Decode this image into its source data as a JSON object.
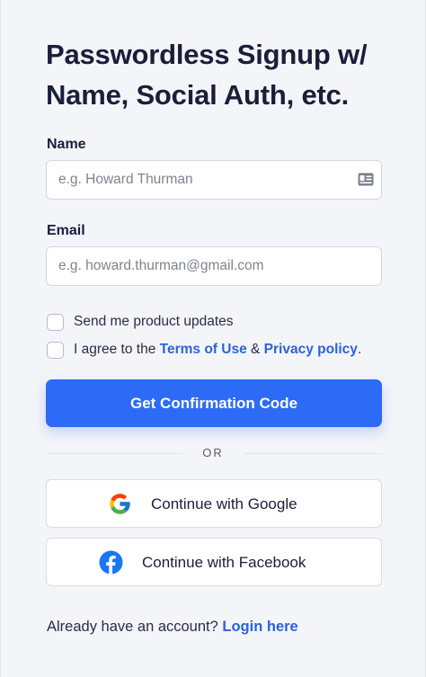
{
  "form": {
    "title_line1": "Passwordless Signup w/",
    "title_line2": "Name, Social Auth, etc.",
    "name": {
      "label": "Name",
      "placeholder": "e.g. Howard Thurman",
      "value": ""
    },
    "email": {
      "label": "Email",
      "placeholder": "e.g. howard.thurman@gmail.com",
      "value": ""
    },
    "updates_checkbox": {
      "label": "Send me product updates",
      "checked": false
    },
    "agree_checkbox": {
      "prefix": "I agree to the ",
      "terms_link": "Terms of Use",
      "amp": " & ",
      "privacy_link": "Privacy policy",
      "suffix": ".",
      "checked": false
    },
    "submit_label": "Get Confirmation Code",
    "divider_text": "OR",
    "google_label": "Continue with Google",
    "facebook_label": "Continue with Facebook",
    "footer": {
      "prefix": "Already have an account? ",
      "link": "Login here"
    }
  },
  "icons": {
    "name_field": "id-card-icon",
    "google": "google-icon",
    "facebook": "facebook-icon"
  },
  "colors": {
    "primary": "#2d6bf6",
    "link": "#2c63d8",
    "text": "#1b1e3a",
    "background": "#f4f5f9",
    "facebook": "#1877f2"
  }
}
